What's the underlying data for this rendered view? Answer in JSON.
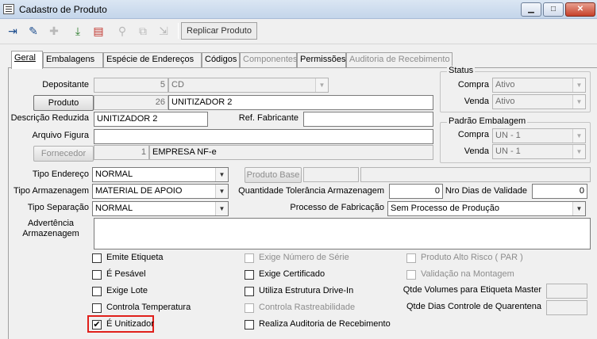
{
  "window": {
    "title": "Cadastro de Produto"
  },
  "toolbar": {
    "replicar_label": "Replicar Produto"
  },
  "tabs": [
    {
      "label": "Geral"
    },
    {
      "label": "Embalagens"
    },
    {
      "label": "Espécie de Endereços"
    },
    {
      "label": "Códigos"
    },
    {
      "label": "Componentes"
    },
    {
      "label": "Permissões"
    },
    {
      "label": "Auditoria de Recebimento"
    }
  ],
  "form": {
    "depositante": {
      "label": "Depositante",
      "code": "5",
      "value": "CD"
    },
    "produto": {
      "button": "Produto",
      "code": "26",
      "value": "UNITIZADOR 2"
    },
    "descricao_reduzida": {
      "label": "Descrição Reduzida",
      "value": "UNITIZADOR 2"
    },
    "ref_fabricante": {
      "label": "Ref. Fabricante",
      "value": ""
    },
    "arquivo_figura": {
      "label": "Arquivo Figura",
      "value": ""
    },
    "fornecedor": {
      "button": "Fornecedor",
      "code": "1",
      "value": "EMPRESA NF-e"
    },
    "status": {
      "title": "Status",
      "compra_label": "Compra",
      "compra": "Ativo",
      "venda_label": "Venda",
      "venda": "Ativo"
    },
    "padrao_embalagem": {
      "title": "Padrão Embalagem",
      "compra_label": "Compra",
      "compra": "UN - 1",
      "venda_label": "Venda",
      "venda": "UN - 1"
    },
    "tipo_endereco": {
      "label": "Tipo Endereço",
      "value": "NORMAL"
    },
    "produto_base": {
      "button": "Produto Base",
      "code": "",
      "value": ""
    },
    "tipo_armazenagem": {
      "label": "Tipo Armazenagem",
      "value": "MATERIAL DE APOIO"
    },
    "qtd_tolerancia": {
      "label": "Quantidade Tolerância Armazenagem",
      "value": "0"
    },
    "nro_dias_validade": {
      "label": "Nro Dias de Validade",
      "value": "0"
    },
    "tipo_separacao": {
      "label": "Tipo Separação",
      "value": "NORMAL"
    },
    "processo_fabricacao": {
      "label": "Processo de Fabricação",
      "value": "Sem Processo de Produção"
    },
    "advertencia": {
      "label1": "Advertência",
      "label2": "Armazenagem",
      "value": ""
    }
  },
  "checks": {
    "col1": [
      {
        "label": "Emite Etiqueta",
        "checked": false
      },
      {
        "label": "É Pesável",
        "checked": false
      },
      {
        "label": "Exige Lote",
        "checked": false
      },
      {
        "label": "Controla Temperatura",
        "checked": false
      },
      {
        "label": "É Unitizador",
        "checked": true
      }
    ],
    "col2": [
      {
        "label": "Exige Número de Série",
        "checked": false,
        "disabled": true
      },
      {
        "label": "Exige Certificado",
        "checked": false,
        "disabled": false
      },
      {
        "label": "Utiliza Estrutura Drive-In",
        "checked": false,
        "disabled": false
      },
      {
        "label": "Controla Rastreabilidade",
        "checked": false,
        "disabled": true
      },
      {
        "label": "Realiza Auditoria de Recebimento",
        "checked": false,
        "disabled": false
      }
    ],
    "col3": [
      {
        "label": "Produto Alto Risco ( PAR )",
        "checked": false,
        "disabled": true
      },
      {
        "label": "Validação na Montagem",
        "checked": false,
        "disabled": true
      }
    ]
  },
  "extra": {
    "qtde_volumes_label": "Qtde Volumes para Etiqueta Master",
    "qtde_volumes_value": "",
    "qtde_dias_label": "Qtde Dias Controle de Quarentena",
    "qtde_dias_value": ""
  },
  "check_mark": "✔",
  "combo_arrow": "▼",
  "highlight_color": "#e0201b"
}
